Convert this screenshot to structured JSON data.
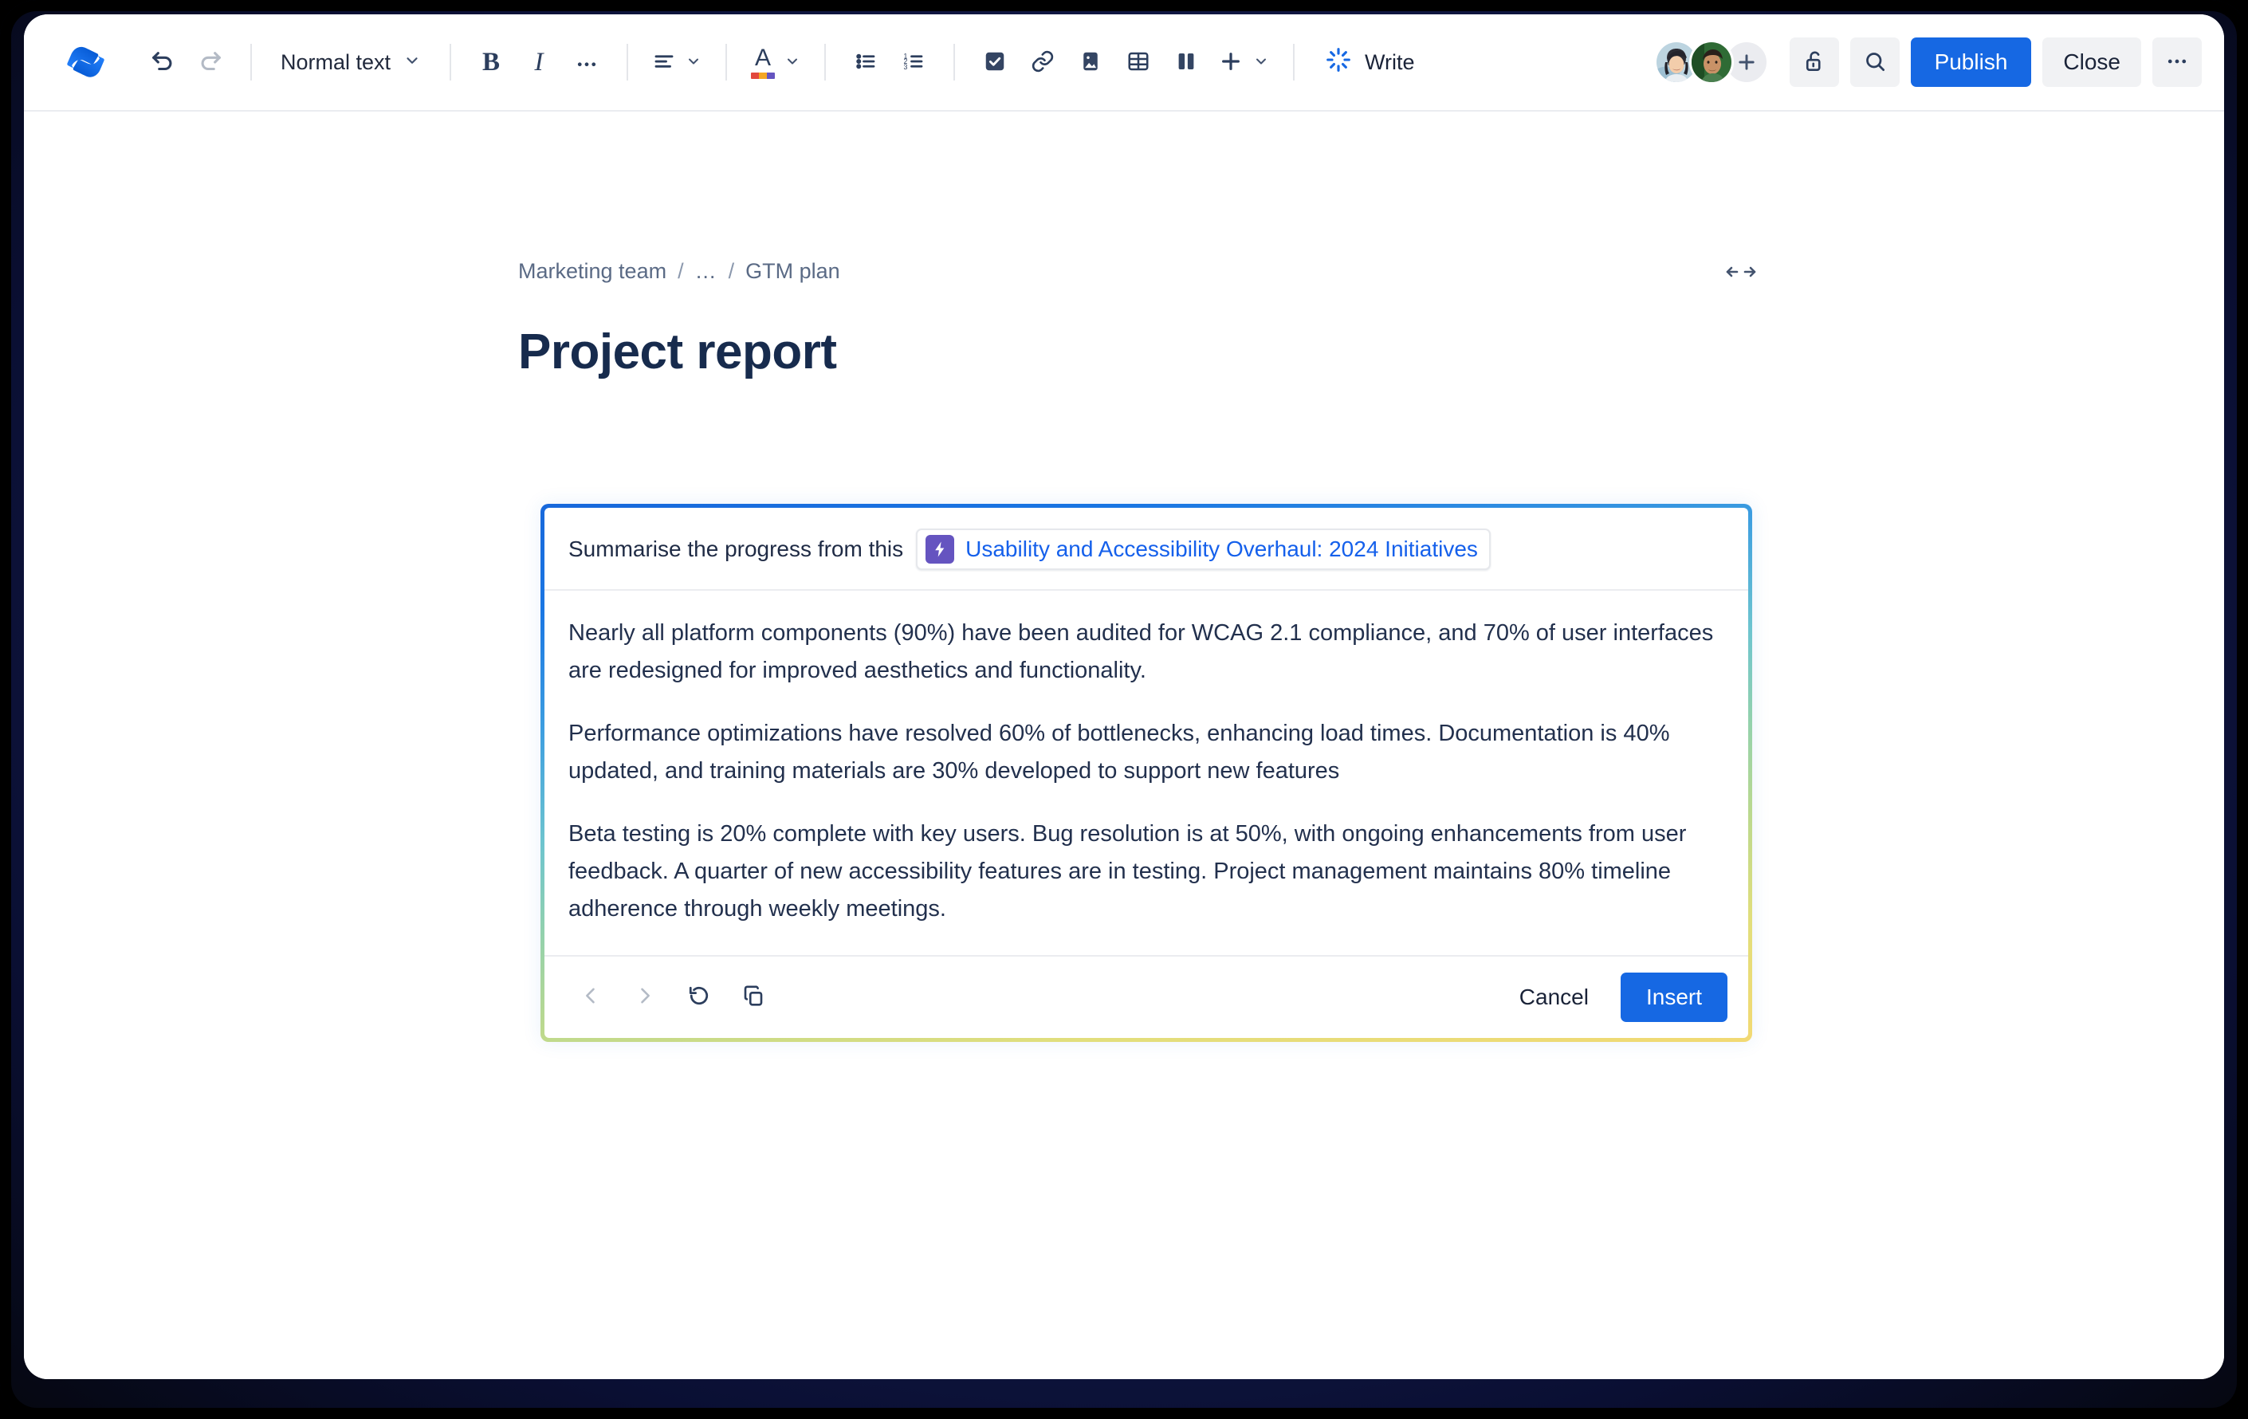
{
  "app": {
    "logo_icon": "confluence-logo-icon"
  },
  "toolbar": {
    "undo_icon": "undo-icon",
    "redo_icon": "redo-icon",
    "text_style": "Normal text",
    "text_style_chevron": "chevron-down-icon",
    "bold_label": "B",
    "italic_label": "I",
    "more_formatting_icon": "ellipsis-icon",
    "align_icon": "text-align-icon",
    "align_chevron": "chevron-down-icon",
    "text_color_label": "A",
    "text_color_chevron": "chevron-down-icon",
    "bullet_list_icon": "bullet-list-icon",
    "numbered_list_icon": "numbered-list-icon",
    "task_icon": "checkbox-icon",
    "link_icon": "link-icon",
    "image_icon": "image-icon",
    "table_icon": "table-icon",
    "layout_icon": "columns-layout-icon",
    "insert_icon": "plus-icon",
    "insert_chevron": "chevron-down-icon",
    "write_icon": "atlassian-intelligence-icon",
    "write_label": "Write",
    "add_people_icon": "plus-icon",
    "restrictions_icon": "unlocked-padlock-icon",
    "search_icon": "search-icon",
    "publish_label": "Publish",
    "close_label": "Close",
    "more_options_icon": "ellipsis-icon",
    "avatars": [
      {
        "name": "avatar-collaborator-1"
      },
      {
        "name": "avatar-collaborator-2"
      }
    ]
  },
  "page": {
    "breadcrumb": {
      "items": [
        "Marketing team",
        "…",
        "GTM plan"
      ],
      "separator": "/"
    },
    "width_toggle_icon": "expand-width-icon",
    "title": "Project report"
  },
  "ai_panel": {
    "prompt_prefix": "Summarise the progress from this",
    "doc_chip": {
      "icon": "page-lightning-icon",
      "label": "Usability and Accessibility Overhaul: 2024 Initiatives"
    },
    "paragraphs": [
      "Nearly all platform components (90%) have been audited for WCAG 2.1 compliance, and 70% of user interfaces are redesigned for improved aesthetics and functionality.",
      "Performance optimizations have resolved 60% of bottlenecks, enhancing load times. Documentation is 40% updated, and training materials are 30% developed to support new features",
      "Beta testing is 20% complete with key users. Bug resolution is at 50%, with ongoing enhancements from user feedback. A quarter of new accessibility features are in testing. Project management maintains 80% timeline adherence through weekly meetings."
    ],
    "footer": {
      "prev_icon": "chevron-left-icon",
      "next_icon": "chevron-right-icon",
      "retry_icon": "refresh-counterclockwise-icon",
      "copy_icon": "copy-icon",
      "cancel_label": "Cancel",
      "insert_label": "Insert"
    }
  },
  "colors": {
    "brand_blue": "#1668e3",
    "link_blue": "#1560eb",
    "chip_purple": "#6554c0",
    "text_dark": "#172b4d",
    "border_gradient_start": "#1868db",
    "border_gradient_mid": "#95d2ab",
    "border_gradient_end": "#f2d973",
    "frame_navy": "#141c4b"
  }
}
